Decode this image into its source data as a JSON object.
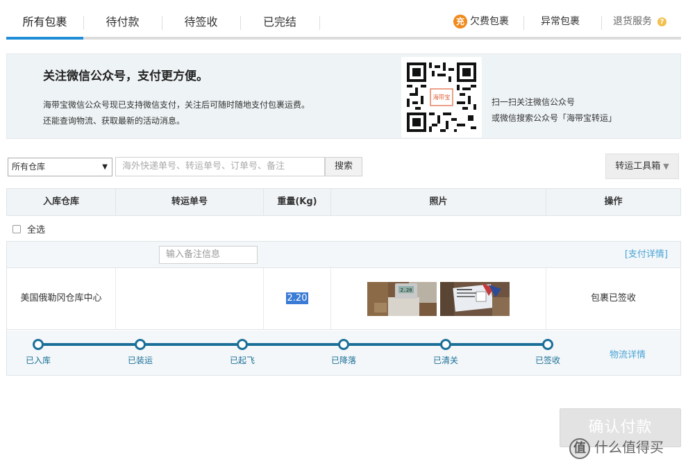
{
  "tabs": {
    "all": "所有包裹",
    "unpaid": "待付款",
    "pending_receipt": "待签收",
    "completed": "已完结"
  },
  "right_links": {
    "arrears_icon": "充",
    "arrears": "欠费包裹",
    "abnormal": "异常包裹",
    "returns": "退货服务",
    "help_icon": "?"
  },
  "banner": {
    "title": "关注微信公众号，支付更方便。",
    "desc_line1": "海带宝微信公众号现已支持微信支付，关注后可随时随地支付包裹运费。",
    "desc_line2": "还能查询物流、获取最新的活动消息。",
    "qr_logo": "海带宝",
    "qr_line1": "扫一扫关注微信公众号",
    "qr_line2": "或微信搜索公众号「海带宝转运」"
  },
  "filters": {
    "warehouse_selected": "所有仓库",
    "search_placeholder": "海外快递单号、转运单号、订单号、备注",
    "search_button": "搜索",
    "toolbox_button": "转运工具箱",
    "toolbox_caret": "▼"
  },
  "table": {
    "headers": [
      "入库仓库",
      "转运单号",
      "重量(Kg)",
      "照片",
      "操作"
    ],
    "select_all": "全选"
  },
  "package": {
    "note_placeholder": "输入备注信息",
    "pay_detail": "[支付详情]",
    "warehouse": "美国俄勒冈仓库中心",
    "tracking_no": "",
    "weight": "2.20",
    "status": "包裹已签收",
    "photo_scale_reading": "2.20",
    "steps": [
      "已入库",
      "已装运",
      "已起飞",
      "已降落",
      "已清关",
      "已签收"
    ],
    "logistics_link": "物流详情"
  },
  "confirm_button": "确认付款",
  "watermark": {
    "badge": "值",
    "text": "什么值得买"
  },
  "colors": {
    "accent": "#1f8ed8",
    "track": "#1a6f98",
    "link": "#4aa3d6",
    "arrears": "#f08a1c"
  }
}
